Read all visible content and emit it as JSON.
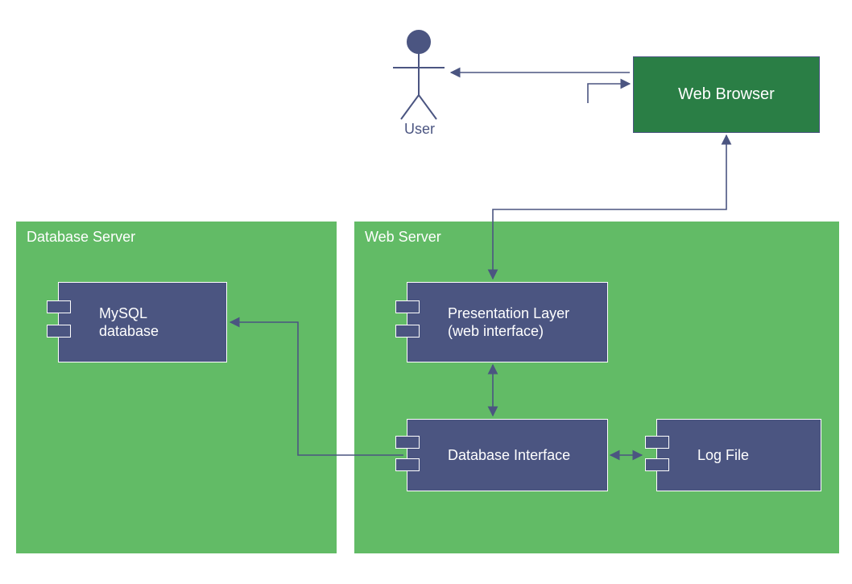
{
  "colors": {
    "actor": "#4b5581",
    "component_fill": "#4b5581",
    "server_fill": "#62bb66",
    "webbrowser_fill": "#2a7e45",
    "text_light": "#ffffff"
  },
  "actor": {
    "label": "User"
  },
  "web_browser": {
    "label": "Web Browser"
  },
  "servers": {
    "database": {
      "title": "Database Server",
      "components": {
        "mysql": {
          "label": "MySQL\ndatabase"
        }
      }
    },
    "web": {
      "title": "Web Server",
      "components": {
        "presentation": {
          "label": "Presentation Layer\n(web interface)"
        },
        "db_interface": {
          "label": "Database Interface"
        },
        "log_file": {
          "label": "Log File"
        }
      }
    }
  },
  "connections": [
    {
      "from": "User",
      "to": "Web Browser",
      "bidirectional": true
    },
    {
      "from": "Web Browser",
      "to": "Presentation Layer",
      "bidirectional": false
    },
    {
      "from": "Presentation Layer",
      "to": "Database Interface",
      "bidirectional": true
    },
    {
      "from": "Database Interface",
      "to": "MySQL database",
      "bidirectional": false
    },
    {
      "from": "Database Interface",
      "to": "Log File",
      "bidirectional": true
    }
  ]
}
